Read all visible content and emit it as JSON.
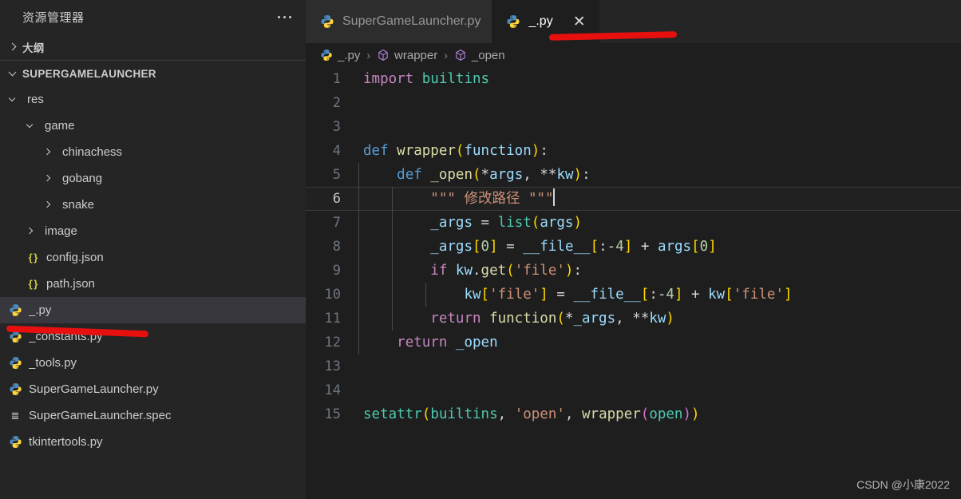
{
  "sidebar": {
    "title": "资源管理器",
    "more_label": "...",
    "sections": [
      {
        "name": "大纲",
        "expanded": false
      },
      {
        "name": "SUPERGAMELAUNCHER",
        "expanded": true
      }
    ],
    "tree": [
      {
        "label": "res",
        "type": "folder",
        "depth": 1,
        "expanded": true,
        "selected": false
      },
      {
        "label": "game",
        "type": "folder",
        "depth": 2,
        "expanded": true,
        "selected": false
      },
      {
        "label": "chinachess",
        "type": "folder",
        "depth": 3,
        "expanded": false,
        "selected": false
      },
      {
        "label": "gobang",
        "type": "folder",
        "depth": 3,
        "expanded": false,
        "selected": false
      },
      {
        "label": "snake",
        "type": "folder",
        "depth": 3,
        "expanded": false,
        "selected": false
      },
      {
        "label": "image",
        "type": "folder",
        "depth": 2,
        "expanded": false,
        "selected": false
      },
      {
        "label": "config.json",
        "type": "json",
        "depth": 2,
        "selected": false
      },
      {
        "label": "path.json",
        "type": "json",
        "depth": 2,
        "selected": false
      },
      {
        "label": "_.py",
        "type": "python",
        "depth": 1,
        "selected": true
      },
      {
        "label": "_constants.py",
        "type": "python",
        "depth": 1,
        "selected": false
      },
      {
        "label": "_tools.py",
        "type": "python",
        "depth": 1,
        "selected": false
      },
      {
        "label": "SuperGameLauncher.py",
        "type": "python",
        "depth": 1,
        "selected": false
      },
      {
        "label": "SuperGameLauncher.spec",
        "type": "spec",
        "depth": 1,
        "selected": false
      },
      {
        "label": "tkintertools.py",
        "type": "python",
        "depth": 1,
        "selected": false
      }
    ]
  },
  "tabs": [
    {
      "label": "SuperGameLauncher.py",
      "icon": "python-icon",
      "active": false,
      "closable": false
    },
    {
      "label": "_.py",
      "icon": "python-icon",
      "active": true,
      "closable": true,
      "close_label": "✕"
    }
  ],
  "breadcrumb": {
    "items": [
      {
        "label": "_.py",
        "icon": "python-icon"
      },
      {
        "label": "wrapper",
        "icon": "symbol-cube-icon"
      },
      {
        "label": "_open",
        "icon": "symbol-cube-icon"
      }
    ],
    "separator": "›"
  },
  "editor": {
    "current_line": 6,
    "lines": [
      {
        "n": "1",
        "text": "import builtins"
      },
      {
        "n": "2",
        "text": ""
      },
      {
        "n": "3",
        "text": ""
      },
      {
        "n": "4",
        "text": "def wrapper(function):"
      },
      {
        "n": "5",
        "text": "    def _open(*args, **kw):"
      },
      {
        "n": "6",
        "text": "        \"\"\" 修改路径 \"\"\""
      },
      {
        "n": "7",
        "text": "        _args = list(args)"
      },
      {
        "n": "8",
        "text": "        _args[0] = __file__[:-4] + args[0]"
      },
      {
        "n": "9",
        "text": "        if kw.get('file'):"
      },
      {
        "n": "10",
        "text": "            kw['file'] = __file__[:-4] + kw['file']"
      },
      {
        "n": "11",
        "text": "        return function(*_args, **kw)"
      },
      {
        "n": "12",
        "text": "    return _open"
      },
      {
        "n": "13",
        "text": ""
      },
      {
        "n": "14",
        "text": ""
      },
      {
        "n": "15",
        "text": "setattr(builtins, 'open', wrapper(open))"
      }
    ]
  },
  "watermark": "CSDN @小康2022",
  "colors": {
    "sidebar_bg": "#252526",
    "editor_bg": "#1e1e1e",
    "tab_inactive_bg": "#2d2d2d",
    "selection_bg": "#37373d",
    "annotation_red": "#e8100f",
    "keyword": "#C586C0",
    "keyword_def": "#569CD6",
    "function": "#DCDCAA",
    "class": "#4EC9B0",
    "variable": "#9CDCFE",
    "string": "#CE9178",
    "number": "#B5CEA8",
    "bracket1": "#FFD700",
    "bracket2": "#DA70D6",
    "bracket3": "#179FFF"
  },
  "annotations": [
    {
      "name": "tab-underline",
      "shape": "red-line"
    },
    {
      "name": "file-underline",
      "shape": "red-line"
    }
  ]
}
